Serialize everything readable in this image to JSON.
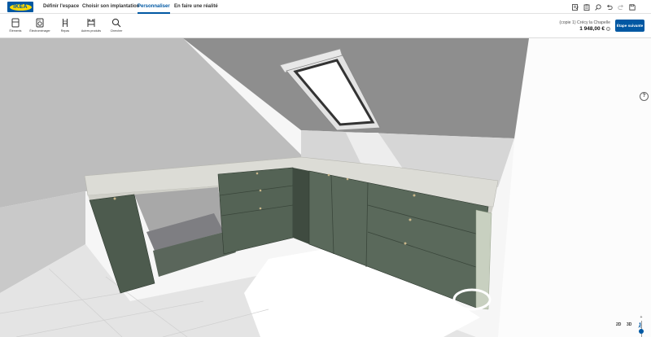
{
  "brand": {
    "logo_text": "IKEA",
    "blue": "#0058a3",
    "yellow": "#ffdb00"
  },
  "nav": {
    "tabs": [
      {
        "label": "Définir l'espace",
        "active": false
      },
      {
        "label": "Choisir son implantation",
        "active": false
      },
      {
        "label": "Personnaliser",
        "active": true
      },
      {
        "label": "En faire une réalité",
        "active": false
      }
    ]
  },
  "top_tools": [
    {
      "icon": "edit-list-icon"
    },
    {
      "icon": "clipboard-icon"
    },
    {
      "icon": "search-zoom-icon"
    },
    {
      "icon": "undo-icon"
    },
    {
      "icon": "redo-icon"
    },
    {
      "icon": "save-icon"
    }
  ],
  "toolbar": {
    "items": [
      {
        "label": "Éléments",
        "icon": "cabinet-icon"
      },
      {
        "label": "Électroménager",
        "icon": "appliance-icon"
      },
      {
        "label": "Repas",
        "icon": "chair-icon"
      },
      {
        "label": "Autres produits",
        "icon": "products-icon"
      },
      {
        "label": "Chercher",
        "icon": "search-icon"
      }
    ]
  },
  "project": {
    "name": "(copie 1) Crécy la Chapelle",
    "price": "1 948,00 €",
    "info_symbol": "i",
    "next_button": "Étape suivante"
  },
  "viewport": {
    "help_symbol": "?",
    "zoom_plus": "+",
    "zoom_minus": "−",
    "zoom_level": 0.6,
    "view_2d": "2D",
    "view_3d": "3D"
  }
}
